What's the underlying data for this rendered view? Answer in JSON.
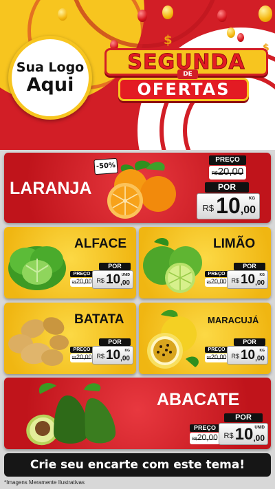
{
  "header": {
    "logo_line1": "Sua Logo",
    "logo_line2": "Aqui",
    "title_line1": "SEGUNDA",
    "title_de": "DE",
    "title_line2": "OFERTAS"
  },
  "colors": {
    "primary_red": "#d21e26",
    "accent_yellow": "#f7c51f",
    "dark": "#111111"
  },
  "products": [
    {
      "name": "LARANJA",
      "badge": "-50%",
      "preco_label": "PREÇO",
      "old_price": "20,00",
      "old_currency": "R$",
      "por_label": "POR",
      "currency": "R$",
      "price_int": "10",
      "price_dec": ",00",
      "unit": "KG",
      "image_icon": "orange-icon"
    },
    {
      "name": "ALFACE",
      "preco_label": "PREÇO",
      "old_price": "20,00",
      "old_currency": "R$",
      "por_label": "POR",
      "currency": "R$",
      "price_int": "10",
      "price_dec": ",00",
      "unit": "UNID",
      "image_icon": "lettuce-icon"
    },
    {
      "name": "LIMÃO",
      "preco_label": "PREÇO",
      "old_price": "20,00",
      "old_currency": "R$",
      "por_label": "POR",
      "currency": "R$",
      "price_int": "10",
      "price_dec": ",00",
      "unit": "KG",
      "image_icon": "lime-icon"
    },
    {
      "name": "BATATA",
      "preco_label": "PREÇO",
      "old_price": "20,00",
      "old_currency": "R$",
      "por_label": "POR",
      "currency": "R$",
      "price_int": "10",
      "price_dec": ",00",
      "unit": "KG",
      "image_icon": "potato-icon"
    },
    {
      "name": "MARACUJÁ",
      "preco_label": "PREÇO",
      "old_price": "20,00",
      "old_currency": "R$",
      "por_label": "POR",
      "currency": "R$",
      "price_int": "10",
      "price_dec": ",00",
      "unit": "KG",
      "image_icon": "passion-fruit-icon"
    },
    {
      "name": "ABACATE",
      "preco_label": "PREÇO",
      "old_price": "20,00",
      "old_currency": "R$",
      "por_label": "POR",
      "currency": "R$",
      "price_int": "10",
      "price_dec": ",00",
      "unit": "UNID",
      "image_icon": "avocado-icon"
    }
  ],
  "footer": {
    "cta": "Crie seu encarte com este tema!",
    "note": "*Imagens Meramente Ilustrativas"
  }
}
